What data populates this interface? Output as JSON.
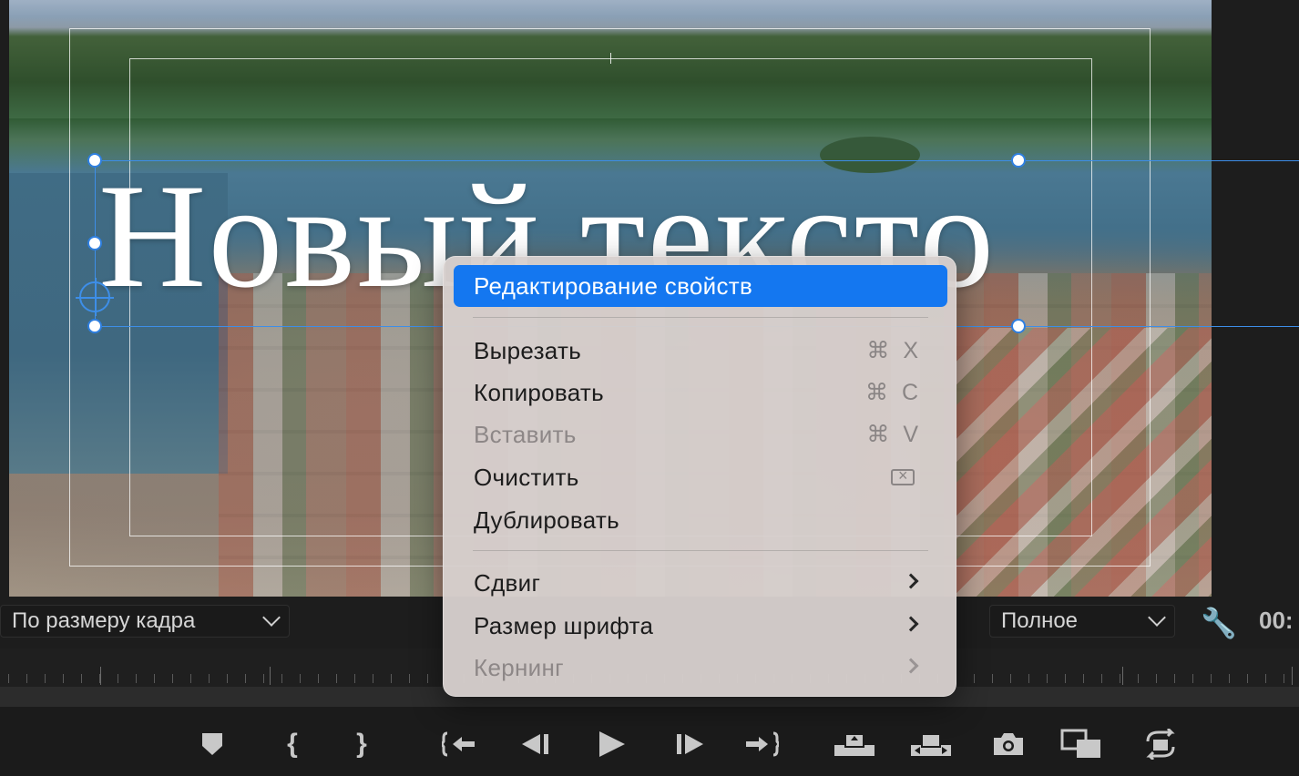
{
  "title_text": "Новый тексто",
  "fit_select": {
    "value": "По размеру кадра"
  },
  "resolution_select": {
    "value": "Полное"
  },
  "timecode": "00:",
  "context_menu": {
    "items": [
      {
        "label": "Редактирование свойств",
        "shortcut": "",
        "state": "highlighted"
      },
      {
        "label": "Вырезать",
        "shortcut": "⌘ X",
        "state": "enabled"
      },
      {
        "label": "Копировать",
        "shortcut": "⌘ C",
        "state": "enabled"
      },
      {
        "label": "Вставить",
        "shortcut": "⌘ V",
        "state": "disabled"
      },
      {
        "label": "Очистить",
        "shortcut_icon": "clear-key-icon",
        "state": "enabled"
      },
      {
        "label": "Дублировать",
        "shortcut": "",
        "state": "enabled"
      },
      {
        "label": "Сдвиг",
        "submenu": true,
        "state": "enabled"
      },
      {
        "label": "Размер шрифта",
        "submenu": true,
        "state": "enabled"
      },
      {
        "label": "Кернинг",
        "submenu": true,
        "state": "disabled"
      }
    ]
  },
  "transport": {
    "icons": {
      "marker": "●",
      "mark_in": "{",
      "mark_out": "}",
      "go_to_in": "{←",
      "step_back": "◀I",
      "play": "▶",
      "step_forward": "I▶",
      "go_to_out": "→}",
      "lift": "⇪",
      "extract": "⇯",
      "export_frame": "📷",
      "insert": "▣",
      "overwrite": "⟲"
    }
  },
  "colors": {
    "accent": "#1477f0",
    "selection": "#3d8ee8"
  }
}
